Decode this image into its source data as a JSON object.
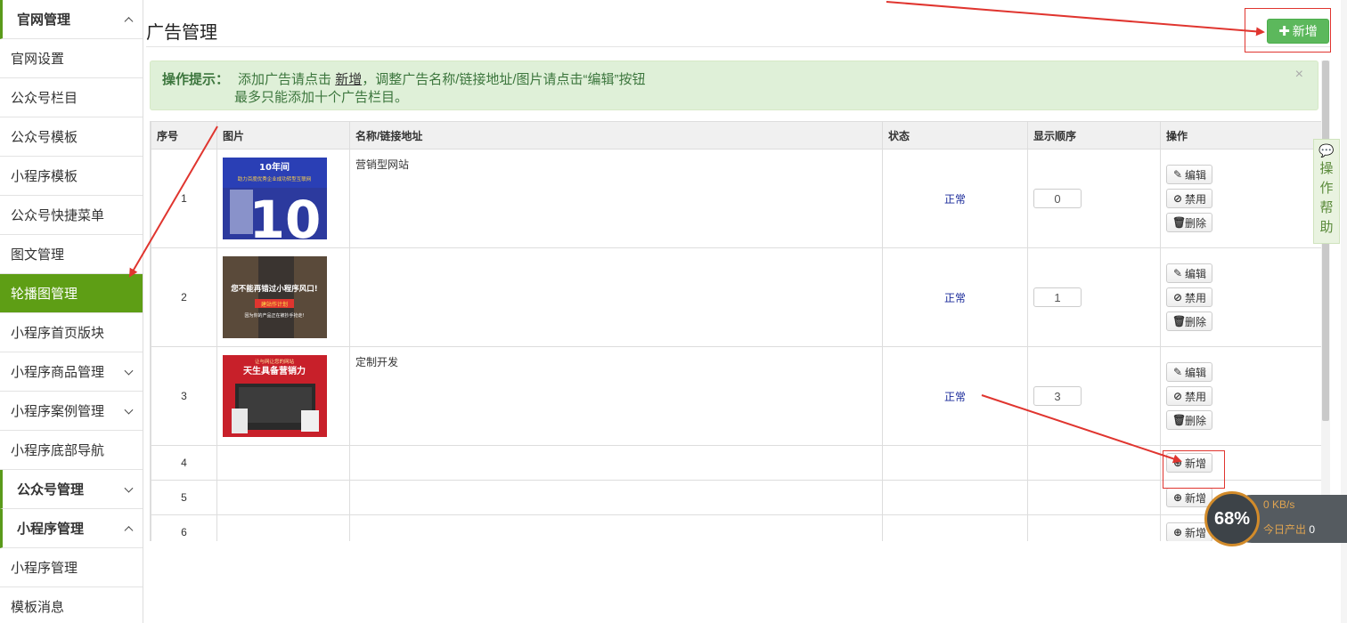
{
  "sidebar": {
    "items": [
      {
        "label": "官网管理",
        "type": "group",
        "chevron": "up"
      },
      {
        "label": "官网设置",
        "type": "item"
      },
      {
        "label": "公众号栏目",
        "type": "item"
      },
      {
        "label": "公众号模板",
        "type": "item"
      },
      {
        "label": "小程序模板",
        "type": "item"
      },
      {
        "label": "公众号快捷菜单",
        "type": "item"
      },
      {
        "label": "图文管理",
        "type": "item"
      },
      {
        "label": "轮播图管理",
        "type": "item",
        "active": true
      },
      {
        "label": "小程序首页版块",
        "type": "item"
      },
      {
        "label": "小程序商品管理",
        "type": "item",
        "chevron": "down"
      },
      {
        "label": "小程序案例管理",
        "type": "item",
        "chevron": "down"
      },
      {
        "label": "小程序底部导航",
        "type": "item"
      },
      {
        "label": "公众号管理",
        "type": "group",
        "chevron": "down"
      },
      {
        "label": "小程序管理",
        "type": "group",
        "chevron": "up"
      },
      {
        "label": "小程序管理",
        "type": "item"
      },
      {
        "label": "模板消息",
        "type": "item"
      }
    ],
    "active_color": "#5e9e15"
  },
  "header": {
    "title": "广告管理",
    "add_button_label": "新增"
  },
  "tip": {
    "label": "操作提示：",
    "line1_prefix": "添加广告请点击",
    "line1_link": "新增",
    "line1_suffix": "，调整广告名称/链接地址/图片请点击“编辑”按钮",
    "line2": "最多只能添加十个广告栏目。",
    "close": "×"
  },
  "table": {
    "columns": [
      "序号",
      "图片",
      "名称/链接地址",
      "状态",
      "显示顺序",
      "操作"
    ],
    "rows": [
      {
        "seq": "1",
        "name": "营销型网站",
        "status": "正常",
        "order": "0",
        "image": {
          "line1": "10年间",
          "line2": "助力百度优秀企业成功转型互联网",
          "big": "10"
        }
      },
      {
        "seq": "2",
        "name": "",
        "status": "正常",
        "order": "1",
        "image": {
          "line1": "您不能再错过小程序风口!",
          "line2": "建站作计划",
          "line3": "因为你的产品正在被抄手抢走!"
        }
      },
      {
        "seq": "3",
        "name": "定制开发",
        "status": "正常",
        "order": "3",
        "image": {
          "line1": "让与网让您的网站",
          "line2": "天生具备营销力"
        }
      },
      {
        "seq": "4"
      },
      {
        "seq": "5"
      },
      {
        "seq": "6"
      }
    ],
    "actions": {
      "edit": "编辑",
      "disable": "禁用",
      "delete": "删除",
      "add": "新增"
    }
  },
  "help_tab": {
    "chars": [
      "操",
      "作",
      "帮",
      "助"
    ]
  },
  "speed_widget": {
    "percent": "68%",
    "rate": "0 KB/s",
    "today_label": "今日产出",
    "today_value": "0"
  },
  "colors": {
    "accent_green": "#5cb85c",
    "tip_bg": "#dff0d8",
    "annotation_red": "#e0352f",
    "status_blue": "#1a2a9a"
  }
}
